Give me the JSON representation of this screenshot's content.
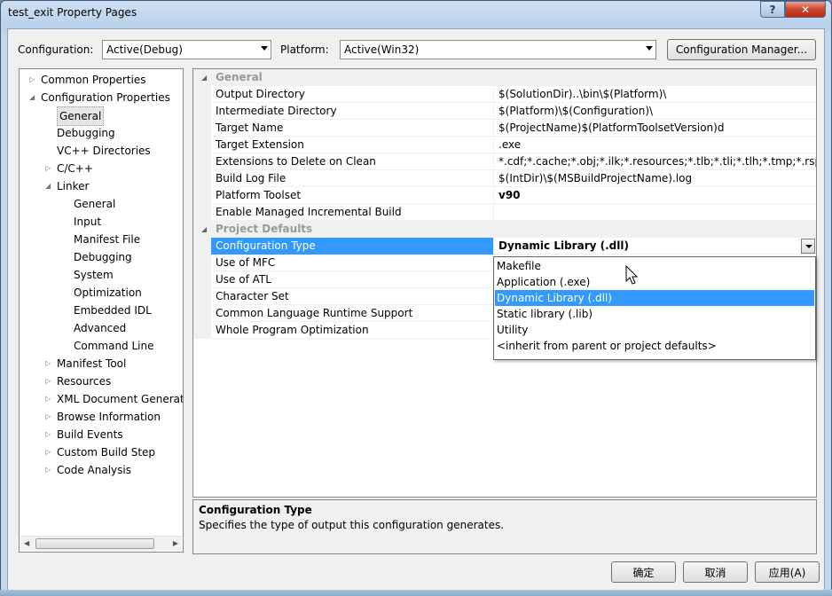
{
  "window": {
    "title": "test_exit Property Pages",
    "help_glyph": "?",
    "close_glyph": "✕"
  },
  "config_bar": {
    "configuration_label": "Configuration:",
    "configuration_value": "Active(Debug)",
    "platform_label": "Platform:",
    "platform_value": "Active(Win32)",
    "manager_button": "Configuration Manager..."
  },
  "tree": {
    "items": [
      {
        "label": "Common Properties",
        "level": 0,
        "expander": "▷"
      },
      {
        "label": "Configuration Properties",
        "level": 0,
        "expander": "◢"
      },
      {
        "label": "General",
        "level": 1,
        "expander": "",
        "selected": true
      },
      {
        "label": "Debugging",
        "level": 1,
        "expander": ""
      },
      {
        "label": "VC++ Directories",
        "level": 1,
        "expander": ""
      },
      {
        "label": "C/C++",
        "level": 1,
        "expander": "▷"
      },
      {
        "label": "Linker",
        "level": 1,
        "expander": "◢"
      },
      {
        "label": "General",
        "level": 2,
        "expander": ""
      },
      {
        "label": "Input",
        "level": 2,
        "expander": ""
      },
      {
        "label": "Manifest File",
        "level": 2,
        "expander": ""
      },
      {
        "label": "Debugging",
        "level": 2,
        "expander": ""
      },
      {
        "label": "System",
        "level": 2,
        "expander": ""
      },
      {
        "label": "Optimization",
        "level": 2,
        "expander": ""
      },
      {
        "label": "Embedded IDL",
        "level": 2,
        "expander": ""
      },
      {
        "label": "Advanced",
        "level": 2,
        "expander": ""
      },
      {
        "label": "Command Line",
        "level": 2,
        "expander": ""
      },
      {
        "label": "Manifest Tool",
        "level": 1,
        "expander": "▷"
      },
      {
        "label": "Resources",
        "level": 1,
        "expander": "▷"
      },
      {
        "label": "XML Document Generat",
        "level": 1,
        "expander": "▷"
      },
      {
        "label": "Browse Information",
        "level": 1,
        "expander": "▷"
      },
      {
        "label": "Build Events",
        "level": 1,
        "expander": "▷"
      },
      {
        "label": "Custom Build Step",
        "level": 1,
        "expander": "▷"
      },
      {
        "label": "Code Analysis",
        "level": 1,
        "expander": "▷"
      }
    ]
  },
  "grid": {
    "categories": [
      {
        "name": "General",
        "rows": [
          {
            "name": "Output Directory",
            "value": "$(SolutionDir)..\\bin\\$(Platform)\\"
          },
          {
            "name": "Intermediate Directory",
            "value": "$(Platform)\\$(Configuration)\\"
          },
          {
            "name": "Target Name",
            "value": "$(ProjectName)$(PlatformToolsetVersion)d"
          },
          {
            "name": "Target Extension",
            "value": ".exe"
          },
          {
            "name": "Extensions to Delete on Clean",
            "value": "*.cdf;*.cache;*.obj;*.ilk;*.resources;*.tlb;*.tli;*.tlh;*.tmp;*.rsp;*.pgc"
          },
          {
            "name": "Build Log File",
            "value": "$(IntDir)\\$(MSBuildProjectName).log"
          },
          {
            "name": "Platform Toolset",
            "value": "v90",
            "bold": true
          },
          {
            "name": "Enable Managed Incremental Build",
            "value": ""
          }
        ]
      },
      {
        "name": "Project Defaults",
        "rows": [
          {
            "name": "Configuration Type",
            "value": "Dynamic Library (.dll)",
            "bold": true,
            "selected": true
          },
          {
            "name": "Use of MFC",
            "value": ""
          },
          {
            "name": "Use of ATL",
            "value": ""
          },
          {
            "name": "Character Set",
            "value": ""
          },
          {
            "name": "Common Language Runtime Support",
            "value": ""
          },
          {
            "name": "Whole Program Optimization",
            "value": ""
          }
        ]
      }
    ]
  },
  "dropdown": {
    "options": [
      {
        "label": "Makefile"
      },
      {
        "label": "Application (.exe)"
      },
      {
        "label": "Dynamic Library (.dll)",
        "highlighted": true
      },
      {
        "label": "Static library (.lib)"
      },
      {
        "label": "Utility"
      },
      {
        "label": "<inherit from parent or project defaults>"
      }
    ]
  },
  "description": {
    "title": "Configuration Type",
    "text": "Specifies the type of output this configuration generates."
  },
  "buttons": {
    "ok": "确定",
    "cancel": "取消",
    "apply": "应用(A)"
  },
  "colors": {
    "selection": "#3399ff",
    "panel": "#f0f0f0"
  }
}
